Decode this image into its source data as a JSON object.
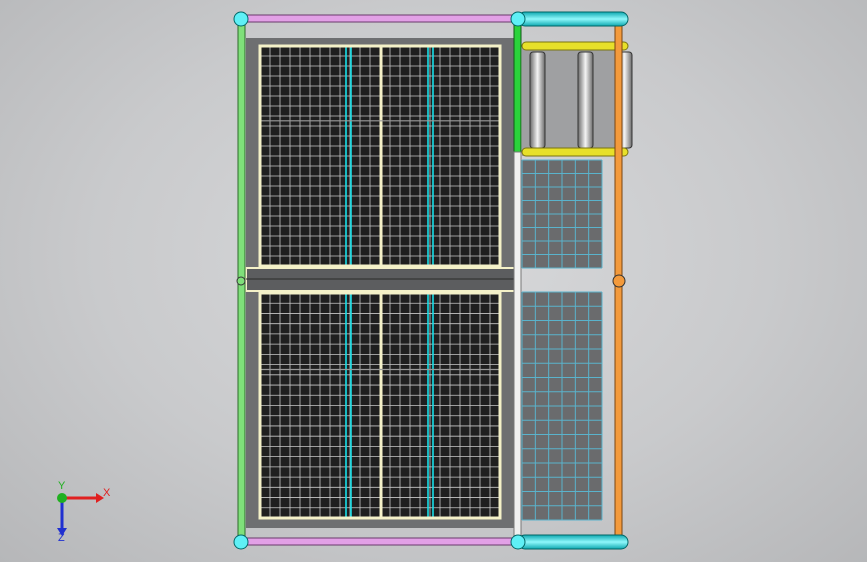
{
  "viewport": {
    "background_color": "#cbcccd"
  },
  "model": {
    "colors": {
      "grid_cell": "#3b3b3b",
      "grid_line": "#c8c8c8",
      "cyan_line": "#16e0e8",
      "frame_light": "#f4f1c8",
      "left_post": "#7fe07a",
      "top_rail": "#e2a0e6",
      "bottom_rail": "#e2a0e6",
      "right_post": "#f39a3c",
      "mid_post": "#2bd33b",
      "white_post": "#f0f0f0",
      "roller_tube": "#16d8e0",
      "yellow_tube": "#e7e02a",
      "steel_blue": "#5ab3cc"
    }
  },
  "triad": {
    "labels": {
      "x": "X",
      "y": "Y",
      "z": "Z"
    },
    "colors": {
      "x": "#e02020",
      "y": "#20b020",
      "z": "#2030d0"
    }
  }
}
